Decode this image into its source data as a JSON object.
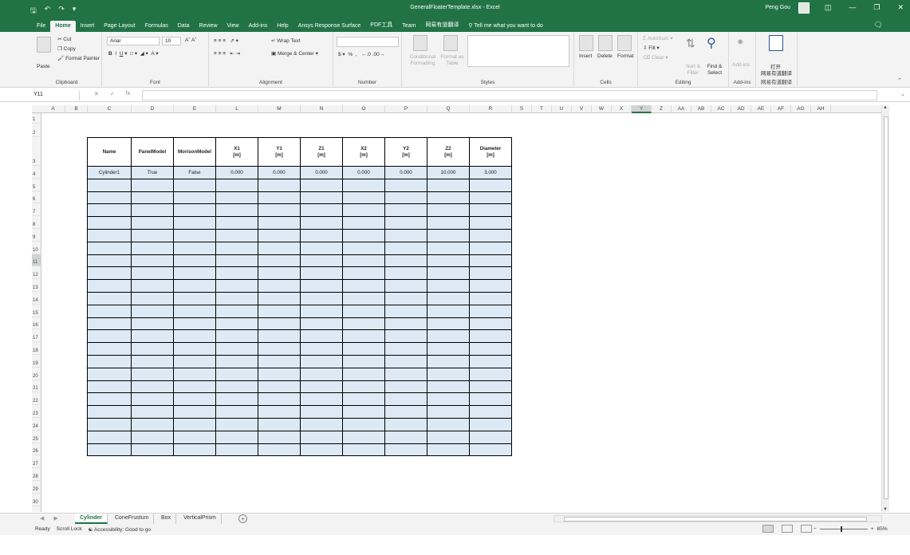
{
  "window": {
    "title": "GeneralFloaterTemplate.xlsx  -  Excel",
    "user": "Peng Gou",
    "qat": [
      "save-icon",
      "undo-icon",
      "redo-icon",
      "customize-icon"
    ],
    "controls": [
      "ribbon-display-icon",
      "minimize-icon",
      "restore-icon",
      "close-icon"
    ]
  },
  "menu_tabs": [
    "File",
    "Home",
    "Insert",
    "Page Layout",
    "Formulas",
    "Data",
    "Review",
    "View",
    "Add-ins",
    "Help",
    "Ansys Response Surface",
    "PDF工具",
    "Team",
    "网易有道翻译"
  ],
  "tell_me": "Tell me what you want to do",
  "ribbon": {
    "clipboard": {
      "paste": "Paste",
      "cut": "Cut",
      "copy": "Copy",
      "format_painter": "Format Painter",
      "label": "Clipboard"
    },
    "font": {
      "name": "Arial",
      "size": "10",
      "label": "Font"
    },
    "alignment": {
      "wrap": "Wrap Text",
      "merge": "Merge & Center",
      "label": "Alignment"
    },
    "number": {
      "currency": "$",
      "percent": "%",
      "label": "Number"
    },
    "styles": {
      "conditional": "Conditional Formatting",
      "format_table": "Format as Table",
      "label": "Styles"
    },
    "cells": {
      "insert": "Insert",
      "delete": "Delete",
      "format": "Format",
      "label": "Cells"
    },
    "editing": {
      "autosum": "AutoSum",
      "fill": "Fill",
      "clear": "Clear",
      "sort": "Sort & Filter",
      "find": "Find & Select",
      "label": "Editing"
    },
    "addins": {
      "button": "Add-ins",
      "label": "Add-ins"
    },
    "youdao": {
      "open": "打开",
      "line2": "网易有道翻译",
      "label": "网易有道翻译"
    }
  },
  "formula_bar": {
    "name_box": "Y11",
    "fx": "fx",
    "value": ""
  },
  "columns": [
    "A",
    "B",
    "C",
    "D",
    "E",
    "L",
    "M",
    "N",
    "O",
    "P",
    "Q",
    "R",
    "S",
    "T",
    "U",
    "V",
    "W",
    "X",
    "Y",
    "Z",
    "AA",
    "AB",
    "AC",
    "AD",
    "AE",
    "AF",
    "AG",
    "AH"
  ],
  "selected_column": "Y",
  "rows": [
    "1",
    "2",
    "3",
    "4",
    "5",
    "6",
    "7",
    "8",
    "9",
    "10",
    "11",
    "12",
    "13",
    "14",
    "15",
    "16",
    "17",
    "18",
    "19",
    "20",
    "21",
    "22",
    "23",
    "24",
    "25",
    "26",
    "27",
    "28",
    "29",
    "30"
  ],
  "selected_row": "11",
  "table": {
    "headers": [
      "Name",
      "PanelModel",
      "MorisonModel",
      "X1\n[m]",
      "Y1\n[m]",
      "Z1\n[m]",
      "X2\n[m]",
      "Y2\n[m]",
      "Z2\n[m]",
      "Diameter\n[m]"
    ],
    "rows": [
      [
        "Cylinder1",
        "True",
        "False",
        "0.000",
        "0.000",
        "0.000",
        "0.000",
        "0.000",
        "10.000",
        "3.000"
      ]
    ],
    "empty_rows": 22
  },
  "sheets": [
    "Cylinder",
    "ConeFrustum",
    "Box",
    "VerticalPrism"
  ],
  "active_sheet": "Cylinder",
  "status": {
    "ready": "Ready",
    "scroll_lock": "Scroll Lock",
    "accessibility": "Accessibility: Good to go",
    "zoom": "85%"
  }
}
